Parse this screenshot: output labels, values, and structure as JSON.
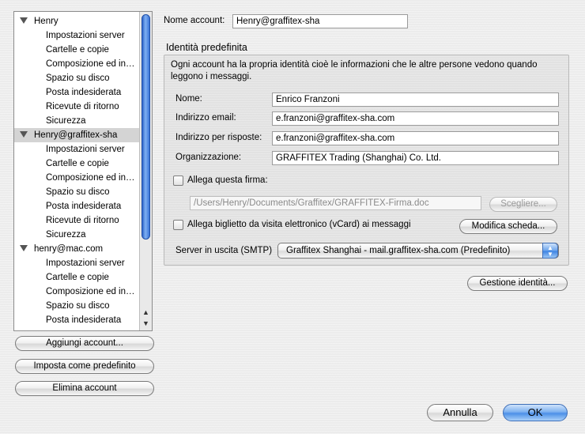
{
  "sidebar": {
    "accounts": [
      {
        "name": "Henry",
        "selected": false,
        "items": [
          "Impostazioni server",
          "Cartelle e copie",
          "Composizione ed in…",
          "Spazio su disco",
          "Posta indesiderata",
          "Ricevute di ritorno",
          "Sicurezza"
        ]
      },
      {
        "name": "Henry@graffitex-sha",
        "selected": true,
        "items": [
          "Impostazioni server",
          "Cartelle e copie",
          "Composizione ed in…",
          "Spazio su disco",
          "Posta indesiderata",
          "Ricevute di ritorno",
          "Sicurezza"
        ]
      },
      {
        "name": "henry@mac.com",
        "selected": false,
        "items": [
          "Impostazioni server",
          "Cartelle e copie",
          "Composizione ed in…",
          "Spazio su disco",
          "Posta indesiderata"
        ]
      }
    ],
    "buttons": {
      "add": "Aggiungi account...",
      "set_default": "Imposta come predefinito",
      "delete": "Elimina account"
    }
  },
  "main": {
    "account_name_label": "Nome account:",
    "account_name_value": "Henry@graffitex-sha",
    "identity_title": "Identità predefinita",
    "identity_desc": "Ogni account ha la propria identità cioè le informazioni che le altre persone vedono quando leggono i messaggi.",
    "fields": {
      "name_label": "Nome:",
      "name_value": "Enrico Franzoni",
      "email_label": "Indirizzo email:",
      "email_value": "e.franzoni@graffitex-sha.com",
      "reply_label": "Indirizzo per risposte:",
      "reply_value": "e.franzoni@graffitex-sha.com",
      "org_label": "Organizzazione:",
      "org_value": "GRAFFITEX Trading (Shanghai) Co. Ltd."
    },
    "signature_checkbox_label": "Allega questa firma:",
    "signature_path": "/Users/Henry/Documents/Graffitex/GRAFFITEX-Firma.doc",
    "choose_button": "Scegliere...",
    "vcard_checkbox_label": "Allega biglietto da visita elettronico (vCard) ai messaggi",
    "edit_card_button": "Modifica scheda...",
    "smtp_label": "Server in uscita (SMTP)",
    "smtp_value": "Graffitex Shanghai - mail.graffitex-sha.com (Predefinito)",
    "manage_identities_button": "Gestione identità..."
  },
  "footer": {
    "cancel": "Annulla",
    "ok": "OK"
  }
}
